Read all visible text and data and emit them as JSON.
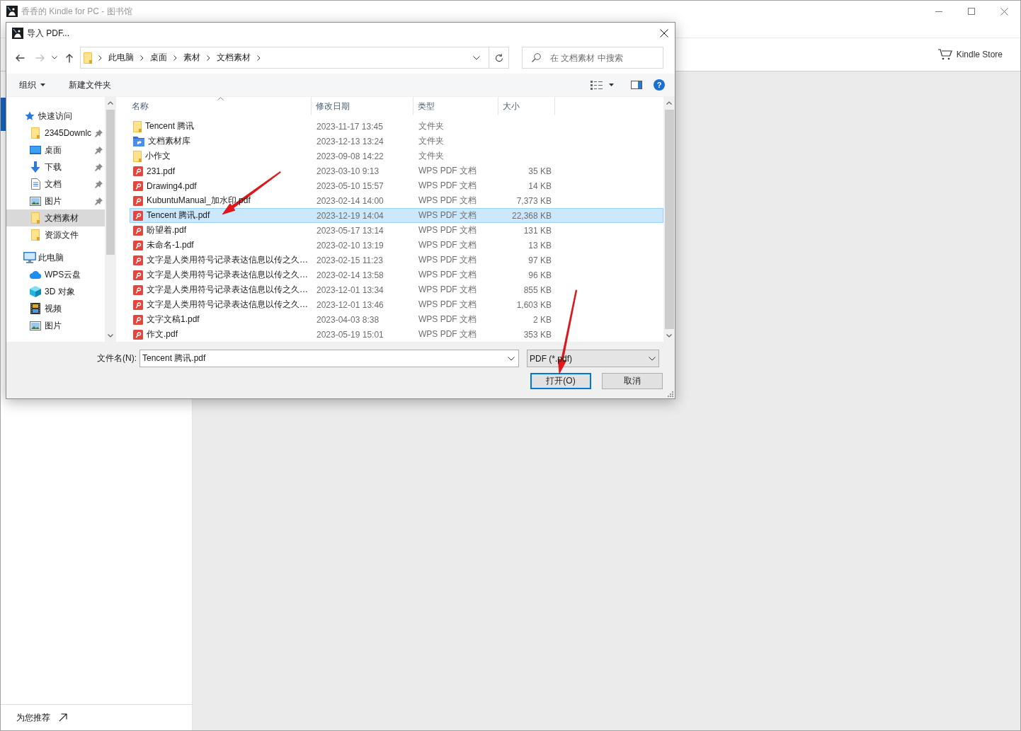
{
  "app": {
    "title": "香香的 Kindle for PC - 图书馆",
    "store_link": "Kindle Store",
    "recommend_link": "为您推荐"
  },
  "dialog": {
    "title": "导入 PDF...",
    "nav_buttons": [
      {
        "kind": "back",
        "disabled": false
      },
      {
        "kind": "forward",
        "disabled": true
      },
      {
        "kind": "recent",
        "disabled": false
      },
      {
        "kind": "up",
        "disabled": false
      }
    ],
    "breadcrumb": [
      "此电脑",
      "桌面",
      "素材",
      "文档素材"
    ],
    "search": {
      "placeholder": "在 文档素材 中搜索"
    },
    "toolbar": {
      "organize": "组织",
      "new_folder": "新建文件夹",
      "help": "?"
    },
    "nav": [
      {
        "label": "快速访问",
        "kind": "star",
        "selected": false,
        "children": [
          {
            "label": "2345Downlc",
            "kind": "folder",
            "pinned": true,
            "selected": false
          },
          {
            "label": "桌面",
            "kind": "desktop",
            "pinned": true,
            "selected": false
          },
          {
            "label": "下载",
            "kind": "download",
            "pinned": true,
            "selected": false
          },
          {
            "label": "文档",
            "kind": "documents",
            "pinned": true,
            "selected": false
          },
          {
            "label": "图片",
            "kind": "pictures",
            "pinned": true,
            "selected": false
          },
          {
            "label": "文档素材",
            "kind": "folder",
            "pinned": false,
            "selected": true
          },
          {
            "label": "资源文件",
            "kind": "folder",
            "pinned": false,
            "selected": false
          }
        ]
      },
      {
        "label": "此电脑",
        "kind": "computer",
        "selected": false,
        "children": [
          {
            "label": "WPS云盘",
            "kind": "cloud",
            "pinned": false,
            "selected": false
          },
          {
            "label": "3D 对象",
            "kind": "cube",
            "pinned": false,
            "selected": false
          },
          {
            "label": "视频",
            "kind": "video",
            "pinned": false,
            "selected": false
          },
          {
            "label": "图片",
            "kind": "pictures",
            "pinned": false,
            "selected": false
          }
        ]
      }
    ],
    "columns": [
      {
        "label": "名称",
        "sorted": true
      },
      {
        "label": "修改日期",
        "sorted": false
      },
      {
        "label": "类型",
        "sorted": false
      },
      {
        "label": "大小",
        "sorted": false
      }
    ],
    "files": [
      {
        "name": "Tencent 腾讯",
        "modified": "2023-11-17 13:45",
        "type": "文件夹",
        "kind": "folder",
        "selected": false
      },
      {
        "name": "文档素材库",
        "modified": "2023-12-13 13:24",
        "type": "文件夹",
        "kind": "library",
        "selected": false
      },
      {
        "name": "小作文",
        "modified": "2023-09-08 14:22",
        "type": "文件夹",
        "kind": "folder",
        "selected": false
      },
      {
        "name": "231.pdf",
        "modified": "2023-03-10 9:13",
        "type": "WPS PDF 文档",
        "size": "35 KB",
        "kind": "pdf",
        "selected": false
      },
      {
        "name": "Drawing4.pdf",
        "modified": "2023-05-10 15:57",
        "type": "WPS PDF 文档",
        "size": "14 KB",
        "kind": "pdf",
        "selected": false
      },
      {
        "name": "KubuntuManual_加水印.pdf",
        "modified": "2023-02-14 14:00",
        "type": "WPS PDF 文档",
        "size": "7,373 KB",
        "kind": "pdf",
        "selected": false
      },
      {
        "name": "Tencent 腾讯.pdf",
        "modified": "2023-12-19 14:04",
        "type": "WPS PDF 文档",
        "size": "22,368 KB",
        "kind": "pdf",
        "selected": true
      },
      {
        "name": "盼望着.pdf",
        "modified": "2023-05-17 13:14",
        "type": "WPS PDF 文档",
        "size": "131 KB",
        "kind": "pdf",
        "selected": false
      },
      {
        "name": "未命名-1.pdf",
        "modified": "2023-02-10 13:19",
        "type": "WPS PDF 文档",
        "size": "13 KB",
        "kind": "pdf",
        "selected": false
      },
      {
        "name": "文字是人类用符号记录表达信息以传之久…",
        "modified": "2023-02-15 11:23",
        "type": "WPS PDF 文档",
        "size": "97 KB",
        "kind": "pdf",
        "selected": false
      },
      {
        "name": "文字是人类用符号记录表达信息以传之久…",
        "modified": "2023-02-14 13:58",
        "type": "WPS PDF 文档",
        "size": "96 KB",
        "kind": "pdf",
        "selected": false
      },
      {
        "name": "文字是人类用符号记录表达信息以传之久…",
        "modified": "2023-12-01 13:34",
        "type": "WPS PDF 文档",
        "size": "855 KB",
        "kind": "pdf",
        "selected": false
      },
      {
        "name": "文字是人类用符号记录表达信息以传之久…",
        "modified": "2023-12-01 13:46",
        "type": "WPS PDF 文档",
        "size": "1,603 KB",
        "kind": "pdf",
        "selected": false
      },
      {
        "name": "文字文稿1.pdf",
        "modified": "2023-04-03 8:38",
        "type": "WPS PDF 文档",
        "size": "2 KB",
        "kind": "pdf",
        "selected": false
      },
      {
        "name": "作文.pdf",
        "modified": "2023-05-19 15:01",
        "type": "WPS PDF 文档",
        "size": "353 KB",
        "kind": "pdf",
        "selected": false
      }
    ],
    "filename": {
      "label": "文件名(N):",
      "value": "Tencent 腾讯.pdf"
    },
    "filetype": {
      "value": "PDF (*.pdf)"
    },
    "buttons": [
      {
        "label": "打开(O)",
        "default": true
      },
      {
        "label": "取消",
        "default": false
      }
    ]
  }
}
